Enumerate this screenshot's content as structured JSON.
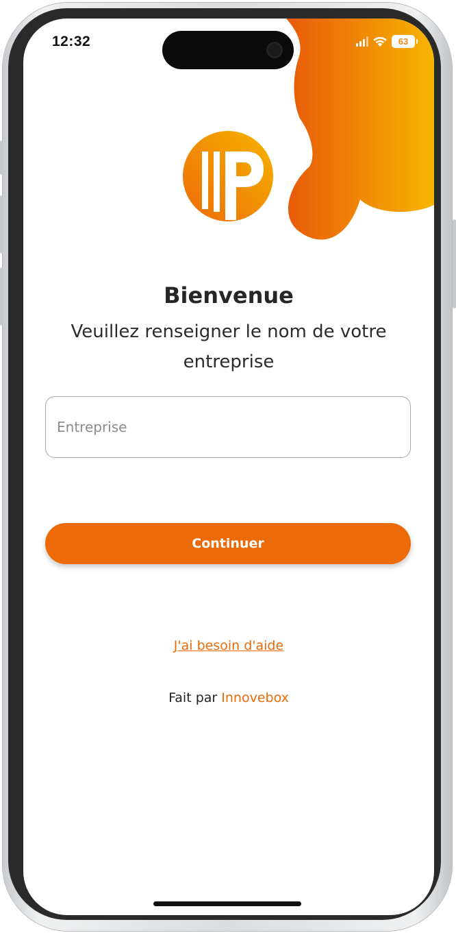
{
  "status_bar": {
    "time": "12:32",
    "battery": "63"
  },
  "brand": {
    "accent": "#ec6a08",
    "gradient_start": "#e8590a",
    "gradient_end": "#f7b500",
    "logo_icon": "ip-logo-icon"
  },
  "welcome": {
    "title": "Bienvenue",
    "subtitle": "Veuillez renseigner le nom de votre entreprise"
  },
  "form": {
    "company_placeholder": "Entreprise",
    "company_value": "",
    "continue_label": "Continuer"
  },
  "footer": {
    "help_link": "J'ai besoin d'aide",
    "made_by_prefix": "Fait par",
    "made_by_brand": "Innovebox"
  }
}
